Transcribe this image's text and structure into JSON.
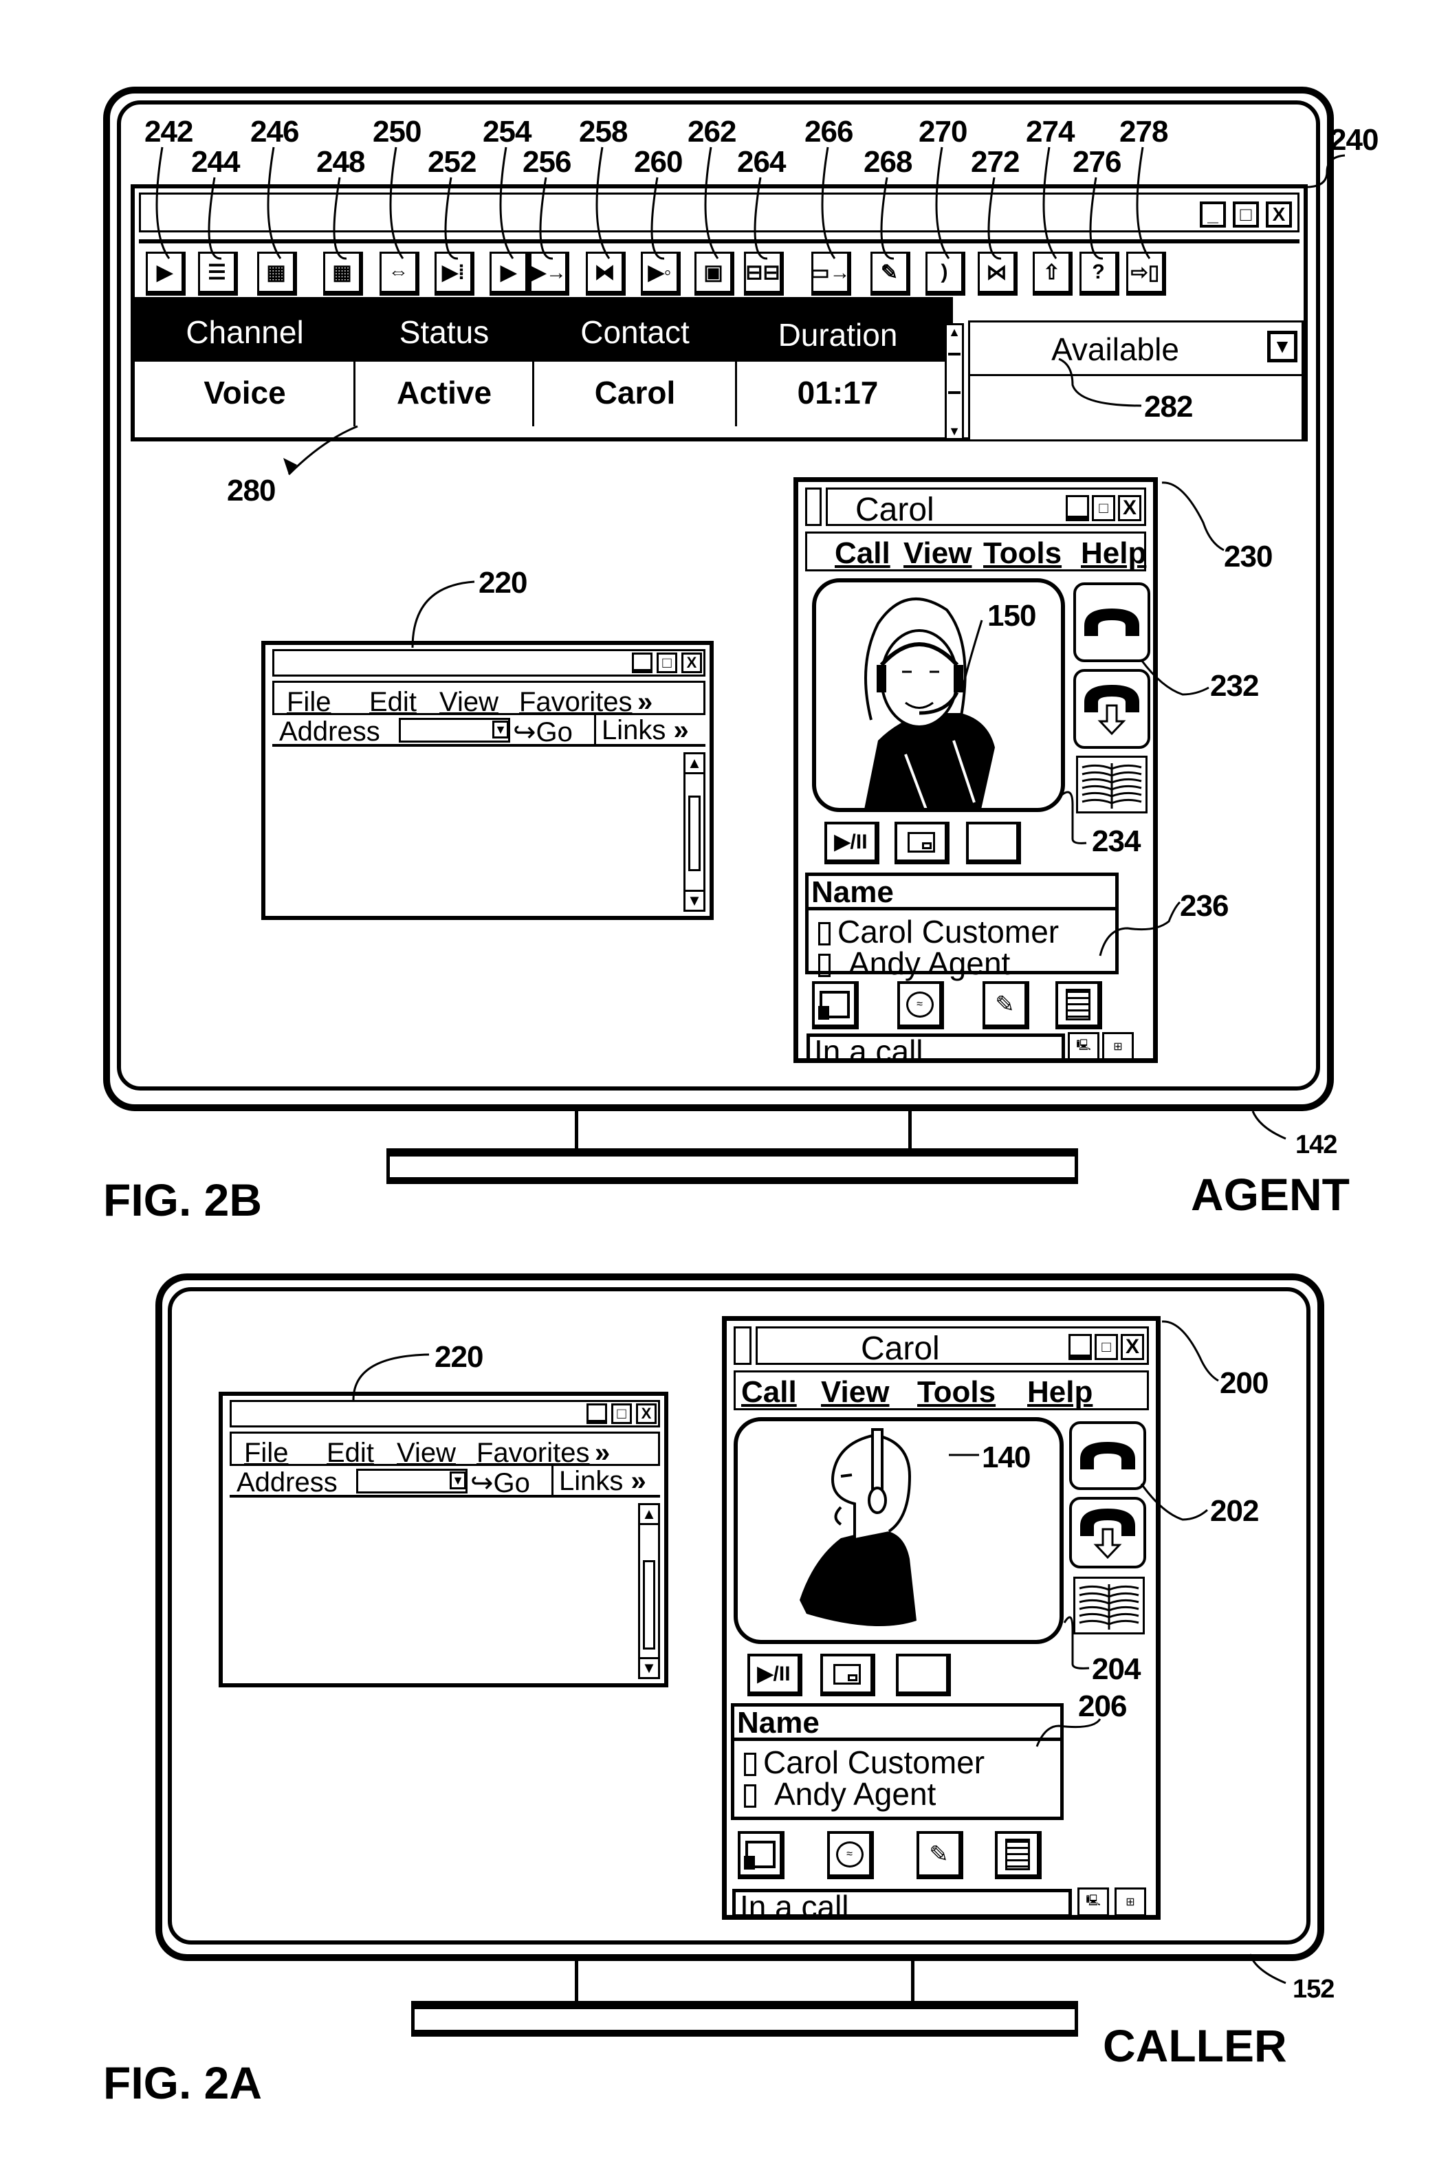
{
  "figure_b": {
    "label": "FIG. 2B",
    "role": "AGENT",
    "monitor_ref": "142",
    "agent_bar": {
      "ref": "240",
      "toolbar_buttons": [
        {
          "ref": "242",
          "icon": "computer-play-icon"
        },
        {
          "ref": "244",
          "icon": "clipboard-form-icon"
        },
        {
          "ref": "246",
          "icon": "dialpad-icon"
        },
        {
          "ref": "248",
          "icon": "grid-icon"
        },
        {
          "ref": "250",
          "icon": "conference-arrows-icon"
        },
        {
          "ref": "252",
          "icon": "release-icon"
        },
        {
          "ref": "254",
          "icon": "play-icon"
        },
        {
          "ref": "256",
          "icon": "forward-icon"
        },
        {
          "ref": "258",
          "icon": "hold-bowtie-icon"
        },
        {
          "ref": "260",
          "icon": "play-timer-icon"
        },
        {
          "ref": "262",
          "icon": "floppy-save-icon"
        },
        {
          "ref": "264",
          "icon": "network-transfer-icon"
        },
        {
          "ref": "266",
          "icon": "folder-arrow-icon"
        },
        {
          "ref": "268",
          "icon": "document-edit-icon"
        },
        {
          "ref": "270",
          "icon": "handset-icon"
        },
        {
          "ref": "272",
          "icon": "broken-line-icon"
        },
        {
          "ref": "274",
          "icon": "up-arrow-icon"
        },
        {
          "ref": "276",
          "icon": "help-question-icon"
        },
        {
          "ref": "278",
          "icon": "exit-door-icon"
        }
      ],
      "window_controls": {
        "minimize": "_",
        "maximize": "□",
        "close": "X"
      },
      "grid": {
        "ref": "280",
        "columns": [
          "Channel",
          "Status",
          "Contact",
          "Duration"
        ],
        "rows": [
          [
            "Voice",
            "Active",
            "Carol",
            "01:17"
          ]
        ]
      },
      "status_dropdown": {
        "ref": "282",
        "selected": "Available"
      }
    },
    "browser": {
      "ref": "220",
      "menu": [
        "File",
        "Edit",
        "View",
        "Favorites"
      ],
      "menu_more": "»",
      "address_label": "Address",
      "address_value": "",
      "go_label": "Go",
      "links_label": "Links",
      "links_more": "»"
    },
    "phone_window": {
      "ref": "230",
      "title": "Carol",
      "menu": [
        "Call",
        "View",
        "Tools",
        "Help"
      ],
      "video_ref": "150",
      "call_buttons_ref": "232",
      "controls_ref": "234",
      "roster_ref": "236",
      "roster_header": "Name",
      "roster": [
        "Carol Customer",
        "Andy Agent"
      ],
      "status": "In a call"
    }
  },
  "figure_a": {
    "label": "FIG. 2A",
    "role": "CALLER",
    "monitor_ref": "152",
    "browser": {
      "ref": "220",
      "menu": [
        "File",
        "Edit",
        "View",
        "Favorites"
      ],
      "menu_more": "»",
      "address_label": "Address",
      "address_value": "",
      "go_label": "Go",
      "links_label": "Links",
      "links_more": "»"
    },
    "phone_window": {
      "ref": "200",
      "title": "Carol",
      "menu": [
        "Call",
        "View",
        "Tools",
        "Help"
      ],
      "video_ref": "140",
      "call_buttons_ref": "202",
      "controls_ref": "204",
      "roster_ref": "206",
      "roster_header": "Name",
      "roster": [
        "Carol Customer",
        "Andy Agent"
      ],
      "status": "In a call"
    }
  }
}
